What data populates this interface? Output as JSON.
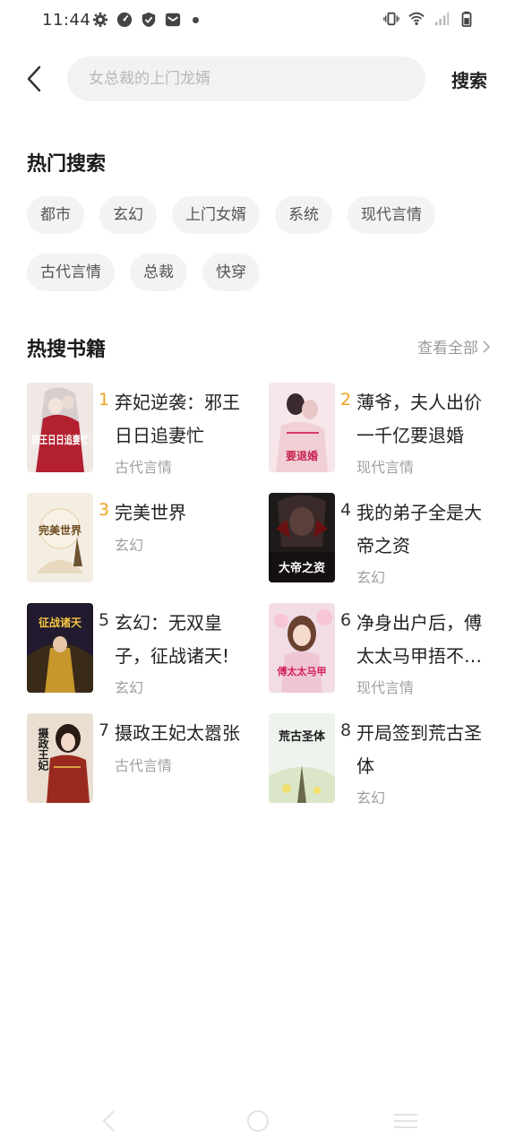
{
  "status_bar": {
    "time": "11:44",
    "left_icons": [
      "gear-icon",
      "speedometer-icon",
      "shield-icon",
      "mail-icon"
    ],
    "right_icons": [
      "vibrate-icon",
      "wifi-icon",
      "signal-icon",
      "battery-icon"
    ]
  },
  "search": {
    "placeholder": "女总裁的上门龙婿",
    "button_label": "搜索"
  },
  "hot_search": {
    "title": "热门搜索",
    "tags_row1": [
      "都市",
      "玄幻",
      "上门女婿",
      "系统",
      "现代言情"
    ],
    "tags_row2": [
      "古代言情",
      "总裁",
      "快穿"
    ]
  },
  "hot_books": {
    "title": "热搜书籍",
    "view_all": "查看全部",
    "books": [
      {
        "rank": "1",
        "title": "弃妃逆袭：邪王日日追妻忙",
        "genre": "古代言情",
        "cover_text": "邪王日日追妻忙"
      },
      {
        "rank": "2",
        "title": "薄爷，夫人出价一千亿要退婚",
        "genre": "现代言情",
        "cover_text": "要退婚"
      },
      {
        "rank": "3",
        "title": "完美世界",
        "genre": "玄幻",
        "cover_text": "完美世界"
      },
      {
        "rank": "4",
        "title": "我的弟子全是大帝之资",
        "genre": "玄幻",
        "cover_text": "大帝之资"
      },
      {
        "rank": "5",
        "title": "玄幻：无双皇子，征战诸天!",
        "genre": "玄幻",
        "cover_text": "征战诸天"
      },
      {
        "rank": "6",
        "title": "净身出户后，傅太太马甲捂不…",
        "genre": "现代言情",
        "cover_text": "傅太太马甲"
      },
      {
        "rank": "7",
        "title": "摄政王妃太嚣张",
        "genre": "古代言情",
        "cover_text": "摄政王妃"
      },
      {
        "rank": "8",
        "title": "开局签到荒古圣体",
        "genre": "玄幻",
        "cover_text": "荒古圣体"
      }
    ]
  },
  "colors": {
    "accent_rank": "#f0a020",
    "tag_bg": "#f3f3f3",
    "muted_text": "#a0a0a0"
  }
}
